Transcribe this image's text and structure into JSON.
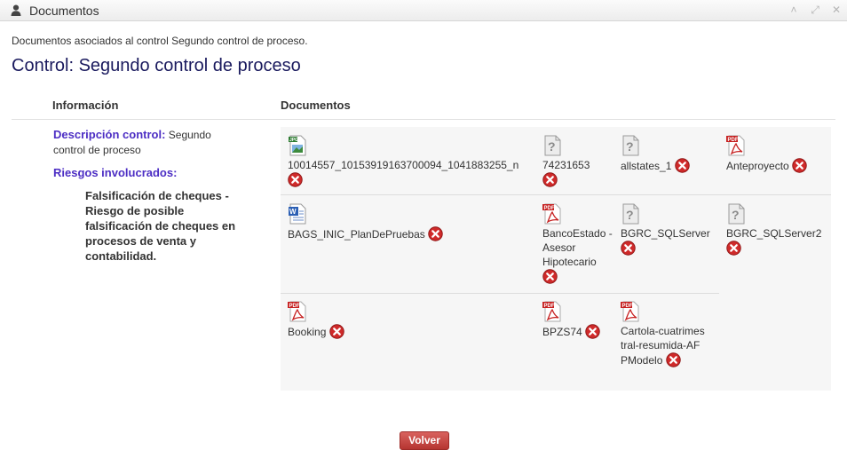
{
  "window": {
    "title": "Documentos"
  },
  "page": {
    "subtitle": "Documentos asociados al control Segundo control de proceso.",
    "heading": "Control: Segundo control de proceso"
  },
  "columns": {
    "info": "Información",
    "docs": "Documentos"
  },
  "info": {
    "descripcion_label": "Descripción control:",
    "descripcion_value": "Segundo control de proceso",
    "riesgos_label": "Riesgos involucrados:",
    "riesgo": "Falsificación de cheques - Riesgo de posible falsificación de cheques en procesos de venta y contabilidad."
  },
  "documents": [
    {
      "name": "10014557_10153919163700094_1041883255_n",
      "icon": "jpg-file-icon"
    },
    {
      "name": "74231653",
      "icon": "unknown-file-icon"
    },
    {
      "name": "allstates_1",
      "icon": "unknown-file-icon"
    },
    {
      "name": "Anteproyecto",
      "icon": "pdf-file-icon"
    },
    {
      "name": "BAGS_INIC_PlanDePruebas",
      "icon": "word-file-icon"
    },
    {
      "name": "BancoEstado - Asesor Hipotecario",
      "icon": "pdf-file-icon"
    },
    {
      "name": "BGRC_SQLServer",
      "icon": "unknown-file-icon"
    },
    {
      "name": "BGRC_SQLServer2",
      "icon": "unknown-file-icon"
    },
    {
      "name": "Booking",
      "icon": "pdf-file-icon"
    },
    {
      "name": "BPZS74",
      "icon": "pdf-file-icon"
    },
    {
      "name": "Cartola-cuatrimestral-resumida-AFPModelo",
      "icon": "pdf-file-icon"
    }
  ],
  "buttons": {
    "volver": "Volver"
  },
  "colors": {
    "accent_label": "#4c2ec4",
    "heading": "#1a1a5e",
    "delete": "#cc2222",
    "volver": "#c9443f"
  }
}
